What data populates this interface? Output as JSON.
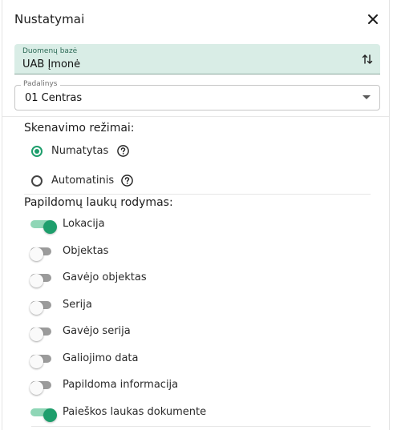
{
  "header": {
    "title": "Nustatymai"
  },
  "database": {
    "label": "Duomenų bazė",
    "value": "UAB Įmonė"
  },
  "division": {
    "label": "Padalinys",
    "value": "01 Centras"
  },
  "scan_modes": {
    "title": "Skenavimo režimai:",
    "options": [
      {
        "label": "Numatytas",
        "selected": true
      },
      {
        "label": "Automatinis",
        "selected": false
      }
    ]
  },
  "extra_fields": {
    "title": "Papildomų laukų rodymas:",
    "toggles": [
      {
        "label": "Lokacija",
        "on": true
      },
      {
        "label": "Objektas",
        "on": false
      },
      {
        "label": "Gavėjo objektas",
        "on": false
      },
      {
        "label": "Serija",
        "on": false
      },
      {
        "label": "Gavėjo serija",
        "on": false
      },
      {
        "label": "Galiojimo data",
        "on": false
      },
      {
        "label": "Papildoma informacija",
        "on": false
      },
      {
        "label": "Paieškos laukas dokumente",
        "on": true
      }
    ]
  },
  "colors": {
    "accent": "#1e9e6c",
    "accent_light": "#8fd6b6",
    "db_background": "#d9ede6"
  }
}
